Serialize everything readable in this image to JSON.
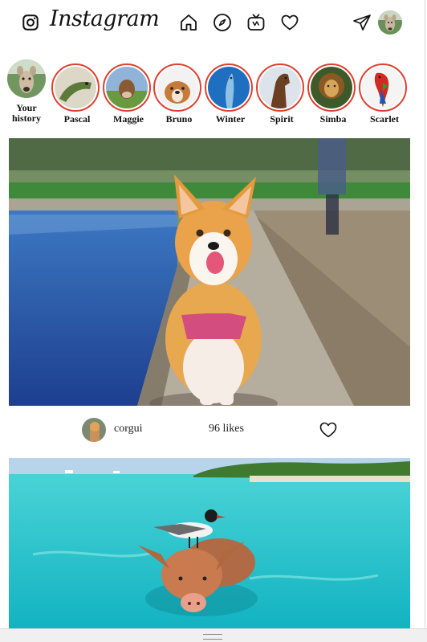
{
  "app": {
    "name": "Instagram"
  },
  "header": {
    "icons": [
      "instagram-logo-icon",
      "home-icon",
      "explore-compass-icon",
      "igtv-icon",
      "heart-icon",
      "direct-send-icon"
    ]
  },
  "stories": [
    {
      "label": "Your history",
      "own": true
    },
    {
      "label": "Pascal"
    },
    {
      "label": "Maggie"
    },
    {
      "label": "Bruno"
    },
    {
      "label": "Winter"
    },
    {
      "label": "Spirit"
    },
    {
      "label": "Simba"
    },
    {
      "label": "Scarlet"
    }
  ],
  "posts": [
    {
      "username": "corgui",
      "likes_text": "96 likes",
      "image": "corgi walking on stone ledge by water"
    },
    {
      "image": "pig swimming in turquoise sea with seagull on its back"
    }
  ],
  "colors": {
    "story_ring": "#e0402f",
    "background": "#ffffff"
  }
}
